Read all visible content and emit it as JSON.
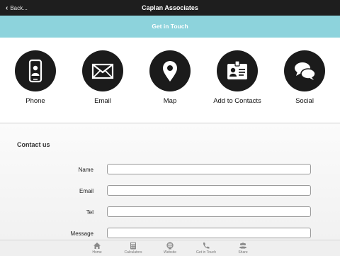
{
  "topbar": {
    "back_label": "Back...",
    "title": "Caplan Associates"
  },
  "banner": {
    "title": "Get in Touch"
  },
  "actions": [
    {
      "label": "Phone",
      "icon": "phone-icon"
    },
    {
      "label": "Email",
      "icon": "envelope-icon"
    },
    {
      "label": "Map",
      "icon": "map-pin-icon"
    },
    {
      "label": "Add to Contacts",
      "icon": "contact-card-icon"
    },
    {
      "label": "Social",
      "icon": "chat-bubbles-icon"
    }
  ],
  "form": {
    "title": "Contact us",
    "fields": [
      {
        "label": "Name",
        "value": ""
      },
      {
        "label": "Email",
        "value": ""
      },
      {
        "label": "Tel",
        "value": ""
      },
      {
        "label": "Message",
        "value": ""
      }
    ]
  },
  "tabbar": [
    {
      "label": "Home",
      "icon": "home-icon"
    },
    {
      "label": "Calculators",
      "icon": "calculator-icon"
    },
    {
      "label": "Website",
      "icon": "globe-icon"
    },
    {
      "label": "Get in Touch",
      "icon": "phone-handset-icon"
    },
    {
      "label": "Share",
      "icon": "people-icon"
    }
  ],
  "colors": {
    "topbar": "#1e1e1e",
    "banner": "#8dd3dc",
    "icon_circle": "#1b1b1b"
  }
}
